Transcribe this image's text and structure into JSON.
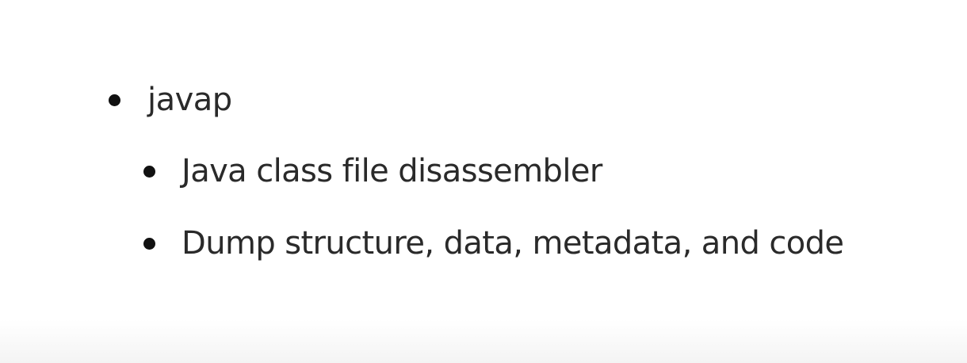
{
  "slide": {
    "bullets": [
      {
        "text": "javap",
        "children": [
          {
            "text": "Java class file disassembler"
          },
          {
            "text": "Dump structure, data, metadata, and code"
          }
        ]
      }
    ]
  }
}
